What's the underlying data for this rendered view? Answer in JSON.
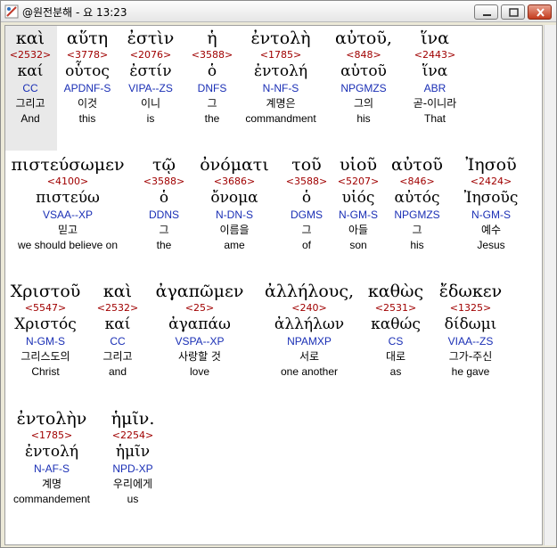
{
  "window": {
    "title": "@원전분해 - 요 13:23"
  },
  "verse_rows": [
    [
      {
        "greek": "καὶ",
        "strong": "<2532>",
        "lemma": "καί",
        "parse": "CC",
        "korean": "그리고",
        "english": "And"
      },
      {
        "greek": "αὕτη",
        "strong": "<3778>",
        "lemma": "οὗτος",
        "parse": "APDNF-S",
        "korean": "이것",
        "english": "this"
      },
      {
        "greek": "ἐστὶν",
        "strong": "<2076>",
        "lemma": "ἐστίν",
        "parse": "VIPA--ZS",
        "korean": "이니",
        "english": "is"
      },
      {
        "greek": "ἡ",
        "strong": "<3588>",
        "lemma": "ὁ",
        "parse": "DNFS",
        "korean": "그",
        "english": "the"
      },
      {
        "greek": "ἐντολὴ",
        "strong": "<1785>",
        "lemma": "ἐντολή",
        "parse": "N-NF-S",
        "korean": "계명은",
        "english": "commandment"
      },
      {
        "greek": "αὐτοῦ,",
        "strong": "<848>",
        "lemma": "αὑτοῦ",
        "parse": "NPGMZS",
        "korean": "그의",
        "english": "his"
      },
      {
        "greek": "ἵνα",
        "strong": "<2443>",
        "lemma": "ἵνα",
        "parse": "ABR",
        "korean": "곧-이니라",
        "english": "That"
      }
    ],
    [
      {
        "greek": "πιστεύσωμεν",
        "strong": "<4100>",
        "lemma": "πιστεύω",
        "parse": "VSAA--XP",
        "korean": "믿고",
        "english": "we should believe on"
      },
      {
        "greek": "τῷ",
        "strong": "<3588>",
        "lemma": "ὁ",
        "parse": "DDNS",
        "korean": "그",
        "english": "the"
      },
      {
        "greek": "ὀνόματι",
        "strong": "<3686>",
        "lemma": "ὄνομα",
        "parse": "N-DN-S",
        "korean": "이름을",
        "english": "ame"
      },
      {
        "greek": "τοῦ",
        "strong": "<3588>",
        "lemma": "ὁ",
        "parse": "DGMS",
        "korean": "그",
        "english": "of"
      },
      {
        "greek": "υἱοῦ",
        "strong": "<5207>",
        "lemma": "υἱός",
        "parse": "N-GM-S",
        "korean": "아들",
        "english": "son"
      },
      {
        "greek": "αὐτοῦ",
        "strong": "<846>",
        "lemma": "αὐτός",
        "parse": "NPGMZS",
        "korean": "그",
        "english": "his"
      },
      {
        "greek": "Ἰησοῦ",
        "strong": "<2424>",
        "lemma": "Ἰησοῦς",
        "parse": "N-GM-S",
        "korean": "예수",
        "english": "Jesus"
      }
    ],
    [
      {
        "greek": "Χριστοῦ",
        "strong": "<5547>",
        "lemma": "Χριστός",
        "parse": "N-GM-S",
        "korean": "그리스도의",
        "english": "Christ"
      },
      {
        "greek": "καὶ",
        "strong": "<2532>",
        "lemma": "καί",
        "parse": "CC",
        "korean": "그리고",
        "english": "and"
      },
      {
        "greek": "ἀγαπῶμεν",
        "strong": "<25>",
        "lemma": "ἀγαπάω",
        "parse": "VSPA--XP",
        "korean": "사랑할 것",
        "english": "love"
      },
      {
        "greek": "ἀλλήλους,",
        "strong": "<240>",
        "lemma": "ἀλλήλων",
        "parse": "NPAMXP",
        "korean": "서로",
        "english": "one another"
      },
      {
        "greek": "καθὼς",
        "strong": "<2531>",
        "lemma": "καθώς",
        "parse": "CS",
        "korean": "대로",
        "english": "as"
      },
      {
        "greek": "ἔδωκεν",
        "strong": "<1325>",
        "lemma": "δίδωμι",
        "parse": "VIAA--ZS",
        "korean": "그가-주신",
        "english": "he gave"
      }
    ],
    [
      {
        "greek": "ἐντολὴν",
        "strong": "<1785>",
        "lemma": "ἐντολή",
        "parse": "N-AF-S",
        "korean": "계명",
        "english": "commandement"
      },
      {
        "greek": "ἡμῖν.",
        "strong": "<2254>",
        "lemma": "ἡμῖν",
        "parse": "NPD-XP",
        "korean": "우리에게",
        "english": "us"
      }
    ]
  ]
}
